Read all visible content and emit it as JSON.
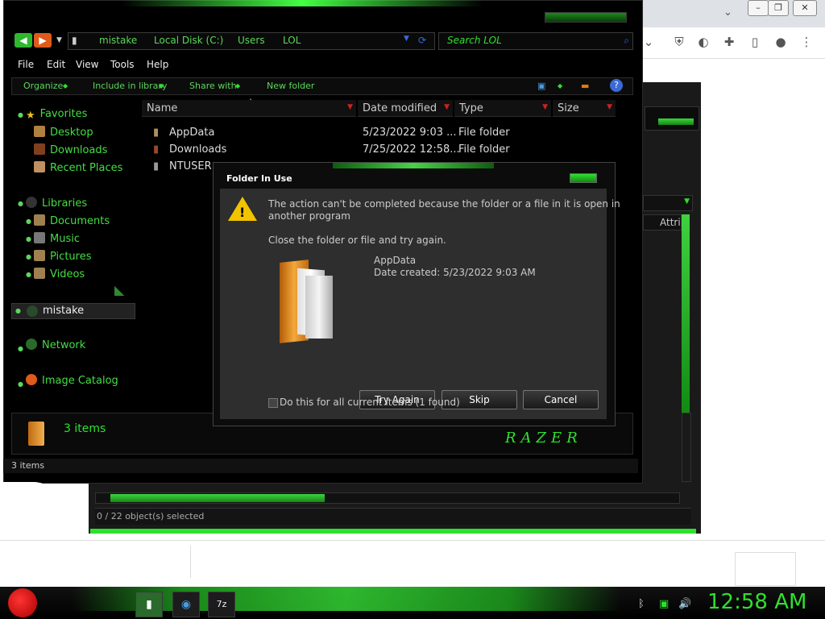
{
  "explorer": {
    "breadcrumb": [
      "mistake",
      "Local Disk (C:)",
      "Users",
      "LOL"
    ],
    "search_placeholder": "Search LOL",
    "menu": [
      "File",
      "Edit",
      "View",
      "Tools",
      "Help"
    ],
    "commands": [
      "Organize",
      "Include in library",
      "Share with",
      "New folder"
    ],
    "sidebar": {
      "favorites": "Favorites",
      "favorites_items": [
        "Desktop",
        "Downloads",
        "Recent Places"
      ],
      "libraries": "Libraries",
      "libraries_items": [
        "Documents",
        "Music",
        "Pictures",
        "Videos"
      ],
      "computer": "mistake",
      "network": "Network",
      "image_catalog": "Image Catalog"
    },
    "columns": [
      "Name",
      "Date modified",
      "Type",
      "Size"
    ],
    "files": [
      {
        "name": "AppData",
        "date": "5/23/2022 9:03 ...",
        "type": "File folder"
      },
      {
        "name": "Downloads",
        "date": "7/25/2022 12:58...",
        "type": "File folder"
      },
      {
        "name": "NTUSER",
        "date": "",
        "type": ""
      }
    ],
    "details_count": "3 items",
    "status": "3 items",
    "brand": "RAZER"
  },
  "dialog": {
    "title": "Folder In Use",
    "message_line1": "The action can't be completed because the folder or a file in it is open in",
    "message_line2": "another program",
    "hint": "Close the folder or file and try again.",
    "item_name": "AppData",
    "item_date": "Date created: 5/23/2022 9:03 AM",
    "buttons": {
      "try_again": "Try Again",
      "skip": "Skip",
      "cancel": "Cancel"
    },
    "checkbox_label": "Do this for all current items (1 found)"
  },
  "background_window": {
    "column": "Attri",
    "status": "0 / 22 object(s) selected"
  },
  "taskbar": {
    "clock": "12:58 AM"
  },
  "colors": {
    "accent": "#2fe02f",
    "dark": "#000000",
    "dialog": "#2e2e2e"
  }
}
